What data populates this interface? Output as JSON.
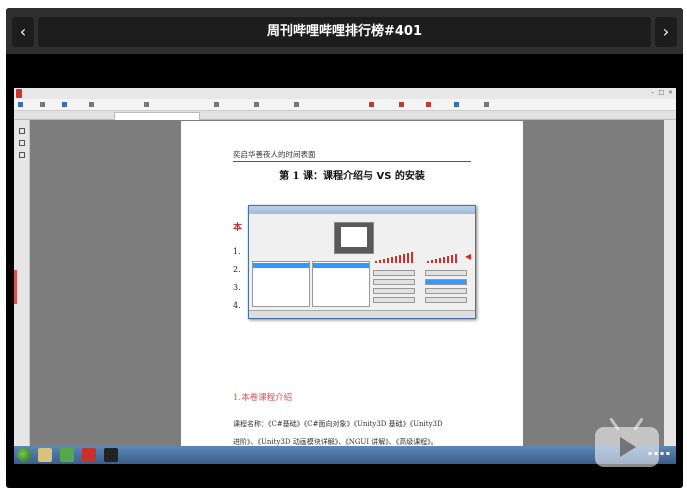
{
  "player": {
    "title": "周刊哔哩哔哩排行榜#401",
    "prev_icon": "chevron-left-icon",
    "next_icon": "chevron-right-icon",
    "prev_glyph": "‹",
    "next_glyph": "›"
  },
  "document": {
    "header": "奕启华善夜人的时间表面",
    "title_a": "第 1 课：课程介绍与 ",
    "title_vs": "VS",
    "title_b": " 的安装",
    "red_fragment": "本",
    "numbers": [
      "1.",
      "2.",
      "3.",
      "4."
    ],
    "section_heading": "1.本卷课程介绍",
    "body_line_1": "课程名称：《C#基础》《C#面向对象》《Unity3D 基础》《Unity3D",
    "body_line_2": "进阶》、《Unity3D 动画模块详解》、《NGUI 讲解》、《高级课程》。"
  },
  "colors": {
    "accent_red": "#c9302c",
    "player_bar": "#2f2f2f"
  }
}
